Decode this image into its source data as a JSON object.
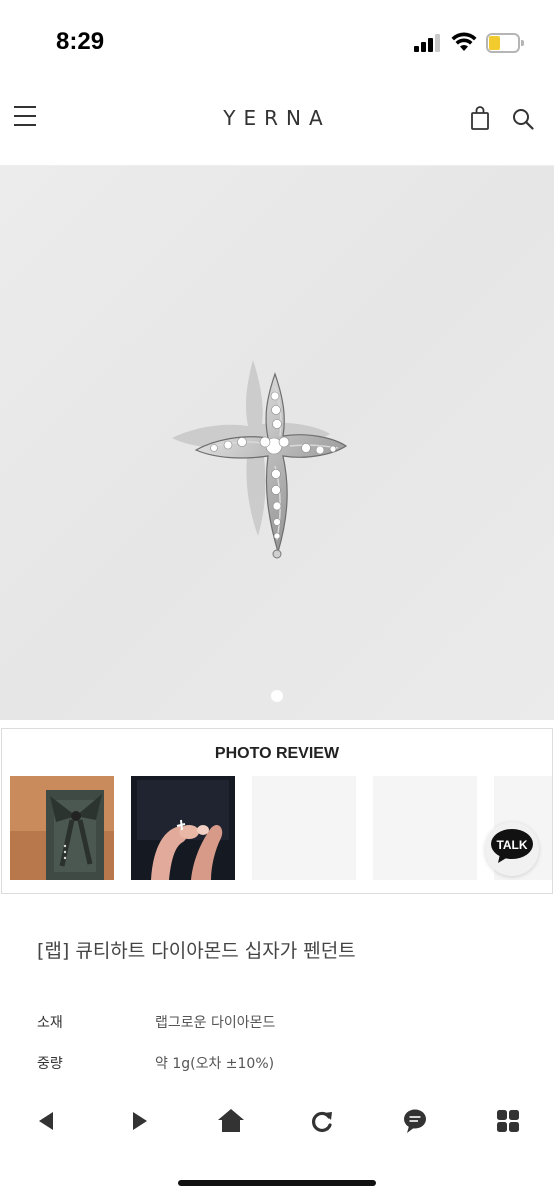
{
  "status_bar": {
    "time": "8:29"
  },
  "header": {
    "brand": "YERNA"
  },
  "product_image": {
    "alt": "cross pendant",
    "slide_count": 1,
    "current_slide": 1
  },
  "photo_review": {
    "title": "PHOTO REVIEW",
    "thumbnails": [
      "review-photo-1",
      "review-photo-2",
      "empty",
      "empty",
      "empty"
    ]
  },
  "chat": {
    "label": "TALK",
    "bubble_color": "#111111"
  },
  "product": {
    "name": "[랩] 큐티하트 다이아몬드 십자가 펜던트",
    "specs": [
      {
        "label": "소재",
        "value": "랩그로운 다이아몬드"
      },
      {
        "label": "중량",
        "value": "약 1g(오차 ±10%)"
      }
    ]
  },
  "toolbar": {
    "buttons": [
      "back-icon",
      "forward-icon",
      "home-icon",
      "refresh-icon",
      "chat-icon",
      "grid-icon"
    ]
  }
}
